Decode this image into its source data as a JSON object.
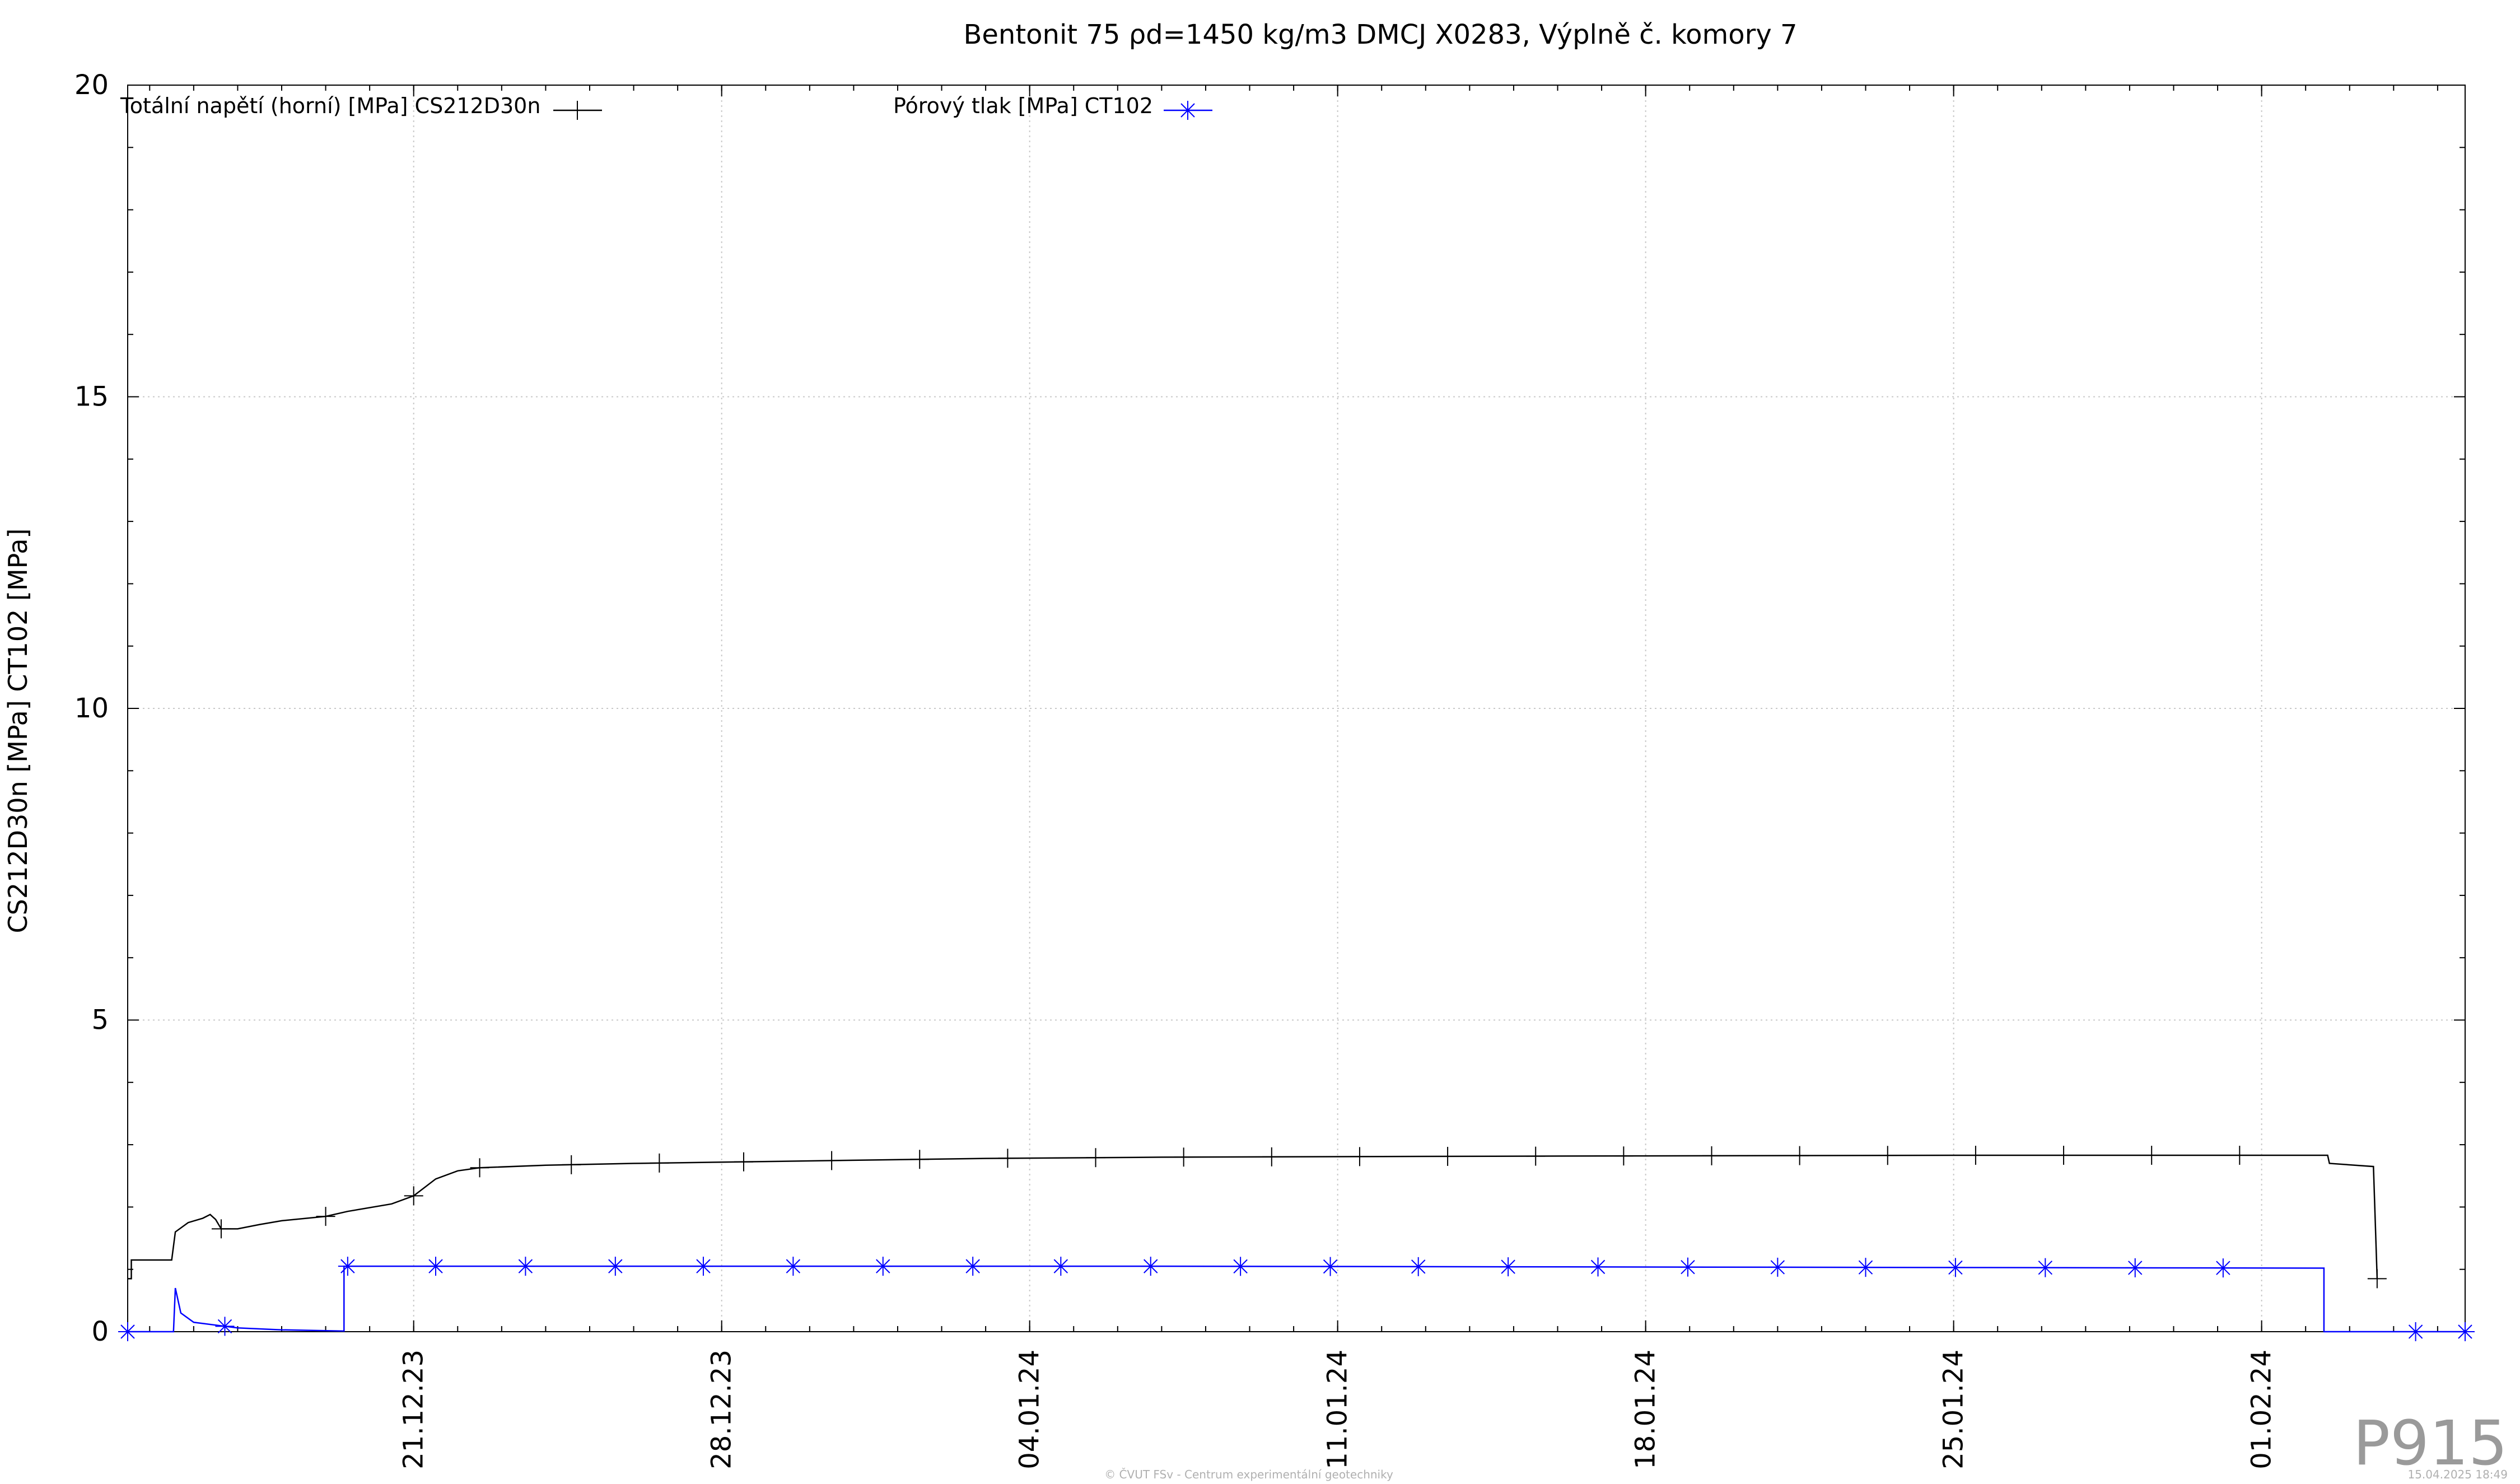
{
  "chart_data": {
    "type": "line",
    "title": "Bentonit 75 ρd=1450 kg/m3 DMCJ X0283, Výplně č. komory 7",
    "ylabel": "CS212D30n [MPa] CT102 [MPa]",
    "xlabel": "",
    "ylim": [
      0,
      20
    ],
    "y_ticks": [
      0,
      5,
      10,
      15,
      20
    ],
    "xlim": [
      "2023-12-14T12:00",
      "2024-02-05T15:00"
    ],
    "x_ticks": [
      {
        "date": "2023-12-21",
        "label": "21.12.23"
      },
      {
        "date": "2023-12-28",
        "label": "28.12.23"
      },
      {
        "date": "2024-01-04",
        "label": "04.01.24"
      },
      {
        "date": "2024-01-11",
        "label": "11.01.24"
      },
      {
        "date": "2024-01-18",
        "label": "18.01.24"
      },
      {
        "date": "2024-01-25",
        "label": "25.01.24"
      },
      {
        "date": "2024-02-01",
        "label": "01.02.24"
      }
    ],
    "grid": true,
    "legend_position": "top",
    "series": [
      {
        "name": "Totální napětí (horní) [MPa] CS212D30n",
        "color": "#000000",
        "marker": "plus",
        "points": [
          [
            "2023-12-14T12:00",
            0.85
          ],
          [
            "2023-12-14T14:00",
            0.85
          ],
          [
            "2023-12-14T14:00",
            1.15
          ],
          [
            "2023-12-15T12:00",
            1.15
          ],
          [
            "2023-12-15T14:00",
            1.6
          ],
          [
            "2023-12-15T21:00",
            1.75
          ],
          [
            "2023-12-16T05:00",
            1.82
          ],
          [
            "2023-12-16T09:00",
            1.88
          ],
          [
            "2023-12-16T12:00",
            1.8
          ],
          [
            "2023-12-16T15:00",
            1.65
          ],
          [
            "2023-12-17T00:00",
            1.65
          ],
          [
            "2023-12-17T12:00",
            1.72
          ],
          [
            "2023-12-18T00:00",
            1.78
          ],
          [
            "2023-12-19T00:00",
            1.85
          ],
          [
            "2023-12-19T12:00",
            1.93
          ],
          [
            "2023-12-20T12:00",
            2.05
          ],
          [
            "2023-12-21T00:00",
            2.18
          ],
          [
            "2023-12-21T12:00",
            2.45
          ],
          [
            "2023-12-22T00:00",
            2.58
          ],
          [
            "2023-12-22T12:00",
            2.63
          ],
          [
            "2023-12-24T00:00",
            2.67
          ],
          [
            "2023-12-26T00:00",
            2.7
          ],
          [
            "2023-12-28T00:00",
            2.72
          ],
          [
            "2023-12-31T00:00",
            2.75
          ],
          [
            "2024-01-03T00:00",
            2.78
          ],
          [
            "2024-01-07T00:00",
            2.8
          ],
          [
            "2024-01-12T00:00",
            2.81
          ],
          [
            "2024-01-18T00:00",
            2.82
          ],
          [
            "2024-01-25T00:00",
            2.83
          ],
          [
            "2024-02-01T12:00",
            2.83
          ],
          [
            "2024-02-02T12:00",
            2.83
          ],
          [
            "2024-02-02T13:00",
            2.7
          ],
          [
            "2024-02-03T13:00",
            2.65
          ],
          [
            "2024-02-03T15:00",
            0.85
          ]
        ],
        "markers": [
          "2023-12-16T15:00",
          "2023-12-19T00:00",
          "2023-12-21T00:00",
          "2023-12-22T12:00",
          "2023-12-24T14:00",
          "2023-12-26T14:00",
          "2023-12-28T12:00",
          "2023-12-30T12:00",
          "2024-01-01T12:00",
          "2024-01-03T12:00",
          "2024-01-05T12:00",
          "2024-01-07T12:00",
          "2024-01-09T12:00",
          "2024-01-11T12:00",
          "2024-01-13T12:00",
          "2024-01-15T12:00",
          "2024-01-17T12:00",
          "2024-01-19T12:00",
          "2024-01-21T12:00",
          "2024-01-23T12:00",
          "2024-01-25T12:00",
          "2024-01-27T12:00",
          "2024-01-29T12:00",
          "2024-01-31T12:00",
          "2024-02-03T15:00"
        ]
      },
      {
        "name": "Pórový tlak [MPa] CT102",
        "color": "#0000ff",
        "marker": "star",
        "points": [
          [
            "2023-12-14T12:00",
            0.0
          ],
          [
            "2023-12-15T13:00",
            0.0
          ],
          [
            "2023-12-15T14:00",
            0.7
          ],
          [
            "2023-12-15T17:00",
            0.3
          ],
          [
            "2023-12-16T00:00",
            0.15
          ],
          [
            "2023-12-17T00:00",
            0.06
          ],
          [
            "2023-12-18T00:00",
            0.03
          ],
          [
            "2023-12-19T10:00",
            0.01
          ],
          [
            "2023-12-19T10:00",
            1.05
          ],
          [
            "2024-01-07T00:00",
            1.05
          ],
          [
            "2024-02-02T10:00",
            1.02
          ],
          [
            "2024-02-02T10:00",
            0.0
          ],
          [
            "2024-02-05T15:00",
            0.0
          ]
        ],
        "markers": [
          "2023-12-14T12:00",
          "2023-12-16T17:00",
          "2023-12-19T12:00",
          "2023-12-21T12:00",
          "2023-12-23T13:00",
          "2023-12-25T14:00",
          "2023-12-27T14:00",
          "2023-12-29T15:00",
          "2023-12-31T16:00",
          "2024-01-02T17:00",
          "2024-01-04T17:00",
          "2024-01-06T18:00",
          "2024-01-08T19:00",
          "2024-01-10T20:00",
          "2024-01-12T20:00",
          "2024-01-14T21:00",
          "2024-01-16T22:00",
          "2024-01-18T23:00",
          "2024-01-21T00:00",
          "2024-01-23T00:00",
          "2024-01-25T01:00",
          "2024-01-27T02:00",
          "2024-01-29T03:00",
          "2024-01-31T03:00",
          "2024-02-04T12:00",
          "2024-02-05T15:00"
        ]
      }
    ]
  },
  "watermark": "P915",
  "footer": {
    "copyright": "© ČVUT FSv - Centrum experimentální geotechniky",
    "timestamp": "15.04.2025 18:49"
  }
}
